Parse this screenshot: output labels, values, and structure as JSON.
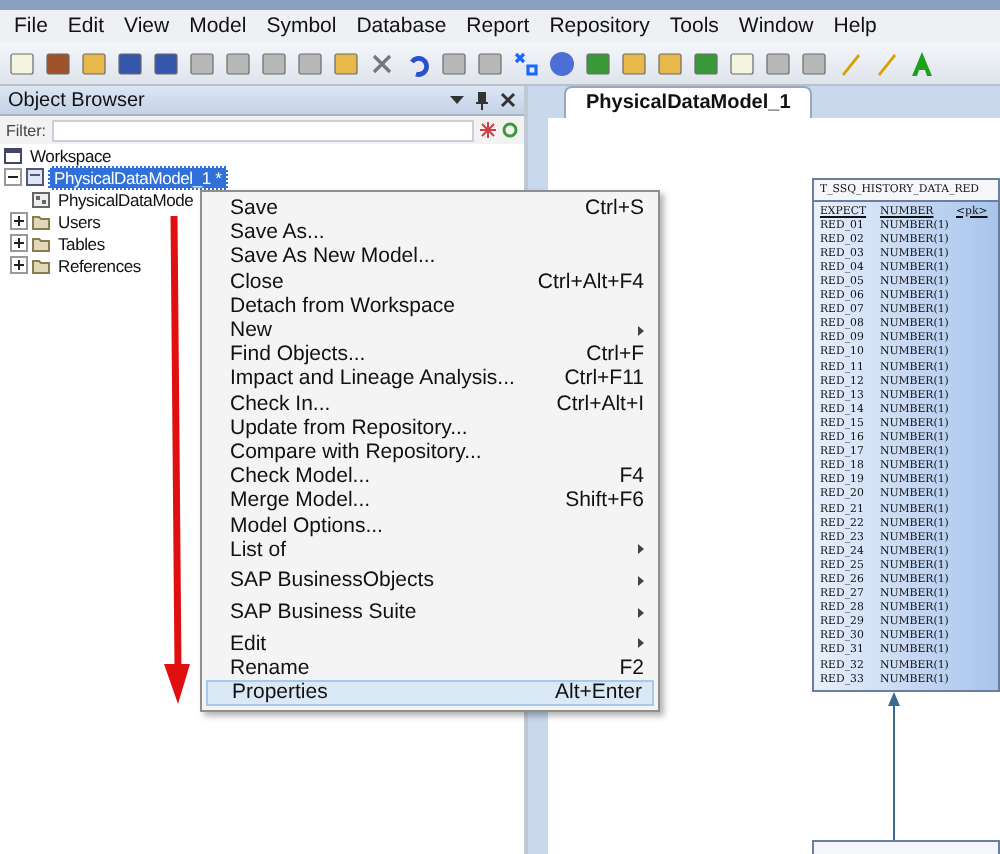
{
  "menu_bar": [
    "File",
    "Edit",
    "View",
    "Model",
    "Symbol",
    "Database",
    "Report",
    "Repository",
    "Tools",
    "Window",
    "Help"
  ],
  "object_browser": {
    "title": "Object Browser",
    "filter": {
      "label": "Filter:"
    },
    "tree": [
      {
        "label": "Workspace",
        "selected": false
      },
      {
        "label": "PhysicalDataModel_1 *",
        "selected": true,
        "expanded": true,
        "children": [
          {
            "label": "PhysicalDataMode",
            "selected": false
          },
          {
            "label": "Users",
            "selected": false,
            "expanded": false
          },
          {
            "label": "Tables",
            "selected": false,
            "expanded": false
          },
          {
            "label": "References",
            "selected": false,
            "expanded": false
          }
        ]
      }
    ]
  },
  "context_menu": [
    {
      "label": "Save",
      "shortcut": "Ctrl+S",
      "submenu": false,
      "selected": false
    },
    {
      "label": "Save As...",
      "submenu": false,
      "selected": false
    },
    {
      "label": "Save As New Model...",
      "submenu": false,
      "selected": false
    },
    {
      "label": "Close",
      "shortcut": "Ctrl+Alt+F4",
      "submenu": false,
      "selected": false
    },
    {
      "label": "Detach from Workspace",
      "submenu": false,
      "selected": false
    },
    {
      "label": "New",
      "submenu": true,
      "selected": false
    },
    {
      "label": "Find Objects...",
      "shortcut": "Ctrl+F",
      "submenu": false,
      "selected": false
    },
    {
      "label": "Impact and Lineage Analysis...",
      "shortcut": "Ctrl+F11",
      "submenu": false,
      "selected": false
    },
    {
      "label": "Check In...",
      "shortcut": "Ctrl+Alt+I",
      "submenu": false,
      "selected": false
    },
    {
      "label": "Update from Repository...",
      "submenu": false,
      "selected": false
    },
    {
      "label": "Compare with Repository...",
      "submenu": false,
      "selected": false
    },
    {
      "label": "Check Model...",
      "shortcut": "F4",
      "submenu": false,
      "selected": false
    },
    {
      "label": "Merge Model...",
      "shortcut": "Shift+F6",
      "submenu": false,
      "selected": false
    },
    {
      "label": "Model Options...",
      "submenu": false,
      "selected": false
    },
    {
      "label": "List of",
      "submenu": true,
      "selected": false
    },
    {
      "label": "SAP BusinessObjects",
      "submenu": true,
      "selected": false
    },
    {
      "label": "SAP Business Suite",
      "submenu": true,
      "selected": false
    },
    {
      "label": "Edit",
      "submenu": true,
      "selected": false
    },
    {
      "label": "Rename",
      "shortcut": "F2",
      "submenu": false,
      "selected": false
    },
    {
      "label": "Properties",
      "shortcut": "Alt+Enter",
      "submenu": false,
      "selected": true
    }
  ],
  "document": {
    "tab": "PhysicalDataModel_1",
    "table": {
      "name": "T_SSQ_HISTORY_DATA_RED",
      "columns": [
        {
          "name": "EXPECT",
          "type": "NUMBER",
          "key": "<pk>"
        },
        {
          "name": "RED_01",
          "type": "NUMBER(1)"
        },
        {
          "name": "RED_02",
          "type": "NUMBER(1)"
        },
        {
          "name": "RED_03",
          "type": "NUMBER(1)"
        },
        {
          "name": "RED_04",
          "type": "NUMBER(1)"
        },
        {
          "name": "RED_05",
          "type": "NUMBER(1)"
        },
        {
          "name": "RED_06",
          "type": "NUMBER(1)"
        },
        {
          "name": "RED_07",
          "type": "NUMBER(1)"
        },
        {
          "name": "RED_08",
          "type": "NUMBER(1)"
        },
        {
          "name": "RED_09",
          "type": "NUMBER(1)"
        },
        {
          "name": "RED_10",
          "type": "NUMBER(1)"
        },
        {
          "name": "RED_11",
          "type": "NUMBER(1)"
        },
        {
          "name": "RED_12",
          "type": "NUMBER(1)"
        },
        {
          "name": "RED_13",
          "type": "NUMBER(1)"
        },
        {
          "name": "RED_14",
          "type": "NUMBER(1)"
        },
        {
          "name": "RED_15",
          "type": "NUMBER(1)"
        },
        {
          "name": "RED_16",
          "type": "NUMBER(1)"
        },
        {
          "name": "RED_17",
          "type": "NUMBER(1)"
        },
        {
          "name": "RED_18",
          "type": "NUMBER(1)"
        },
        {
          "name": "RED_19",
          "type": "NUMBER(1)"
        },
        {
          "name": "RED_20",
          "type": "NUMBER(1)"
        },
        {
          "name": "RED_21",
          "type": "NUMBER(1)"
        },
        {
          "name": "RED_22",
          "type": "NUMBER(1)"
        },
        {
          "name": "RED_23",
          "type": "NUMBER(1)"
        },
        {
          "name": "RED_24",
          "type": "NUMBER(1)"
        },
        {
          "name": "RED_25",
          "type": "NUMBER(1)"
        },
        {
          "name": "RED_26",
          "type": "NUMBER(1)"
        },
        {
          "name": "RED_27",
          "type": "NUMBER(1)"
        },
        {
          "name": "RED_28",
          "type": "NUMBER(1)"
        },
        {
          "name": "RED_29",
          "type": "NUMBER(1)"
        },
        {
          "name": "RED_30",
          "type": "NUMBER(1)"
        },
        {
          "name": "RED_31",
          "type": "NUMBER(1)"
        },
        {
          "name": "RED_32",
          "type": "NUMBER(1)"
        },
        {
          "name": "RED_33",
          "type": "NUMBER(1)"
        }
      ]
    }
  }
}
